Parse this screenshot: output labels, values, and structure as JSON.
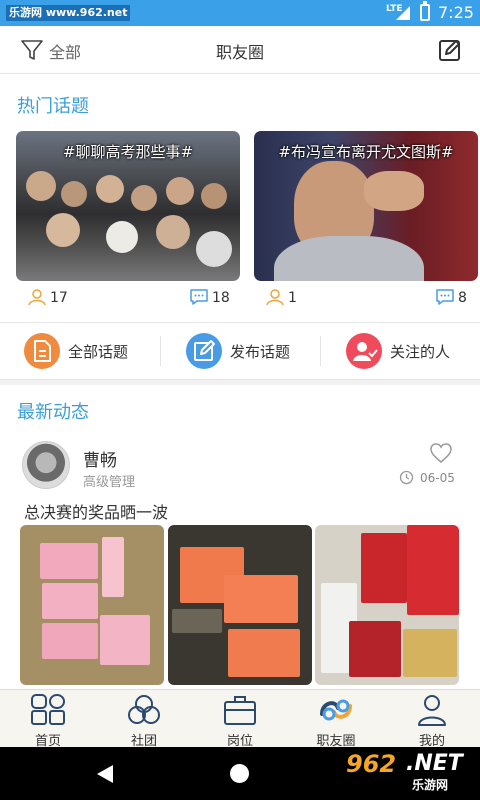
{
  "status_bar": {
    "site_label": "乐游网 www.962.net",
    "network": "LTE",
    "time": "7:25"
  },
  "header": {
    "filter_label": "全部",
    "title": "职友圈",
    "filter_icon": "filter-icon",
    "edit_icon": "edit-icon"
  },
  "hot_topics": {
    "title": "热门话题",
    "items": [
      {
        "hashtag": "#聊聊高考那些事#",
        "followers": "17",
        "comments": "18"
      },
      {
        "hashtag": "#布冯宣布离开尤文图斯#",
        "followers": "1",
        "comments": "8"
      }
    ]
  },
  "actions": [
    {
      "label": "全部话题",
      "icon": "document-icon",
      "color": "#f08a3e"
    },
    {
      "label": "发布话题",
      "icon": "edit-icon",
      "color": "#4a9be6"
    },
    {
      "label": "关注的人",
      "icon": "user-check-icon",
      "color": "#ef4b5c"
    }
  ],
  "latest": {
    "title": "最新动态",
    "post": {
      "user": "曹畅",
      "role": "高级管理",
      "date": "06-05",
      "text": "总决赛的奖品晒一波"
    }
  },
  "tabbar": {
    "items": [
      {
        "label": "首页",
        "icon": "home-grid-icon"
      },
      {
        "label": "社团",
        "icon": "club-icon"
      },
      {
        "label": "岗位",
        "icon": "briefcase-icon"
      },
      {
        "label": "职友圈",
        "icon": "friends-circle-icon",
        "active": true
      },
      {
        "label": "我的",
        "icon": "profile-icon"
      }
    ]
  },
  "watermark": {
    "brand": "962",
    "suffix": ".NET",
    "sub": "乐游网"
  },
  "colors": {
    "status_bar": "#3aa1e8",
    "accent": "#3b9ed9",
    "icon_orange": "#f0a43a",
    "icon_blue": "#4a9be6"
  }
}
